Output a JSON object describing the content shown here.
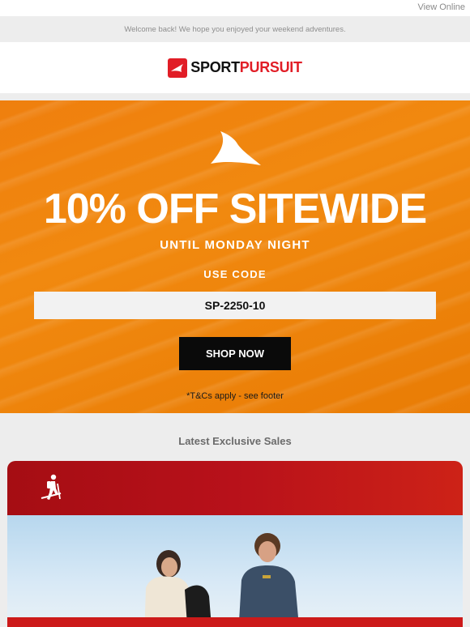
{
  "topbar": {
    "view_online": "View Online"
  },
  "welcome": {
    "text": "Welcome back! We hope you enjoyed your weekend adventures."
  },
  "logo": {
    "part1": "SPORT",
    "part2": "PURSUIT",
    "brand_color": "#e11d26"
  },
  "hero": {
    "title": "10% OFF SITEWIDE",
    "subtitle": "UNTIL MONDAY NIGHT",
    "use_code_label": "USE CODE",
    "code": "SP-2250-10",
    "cta": "SHOP NOW",
    "terms": "*T&Cs apply - see footer",
    "bg_color": "#ef8209"
  },
  "sales": {
    "title": "Latest Exclusive Sales"
  },
  "card": {
    "icon": "hiker-icon",
    "header_color": "#b8111a"
  }
}
